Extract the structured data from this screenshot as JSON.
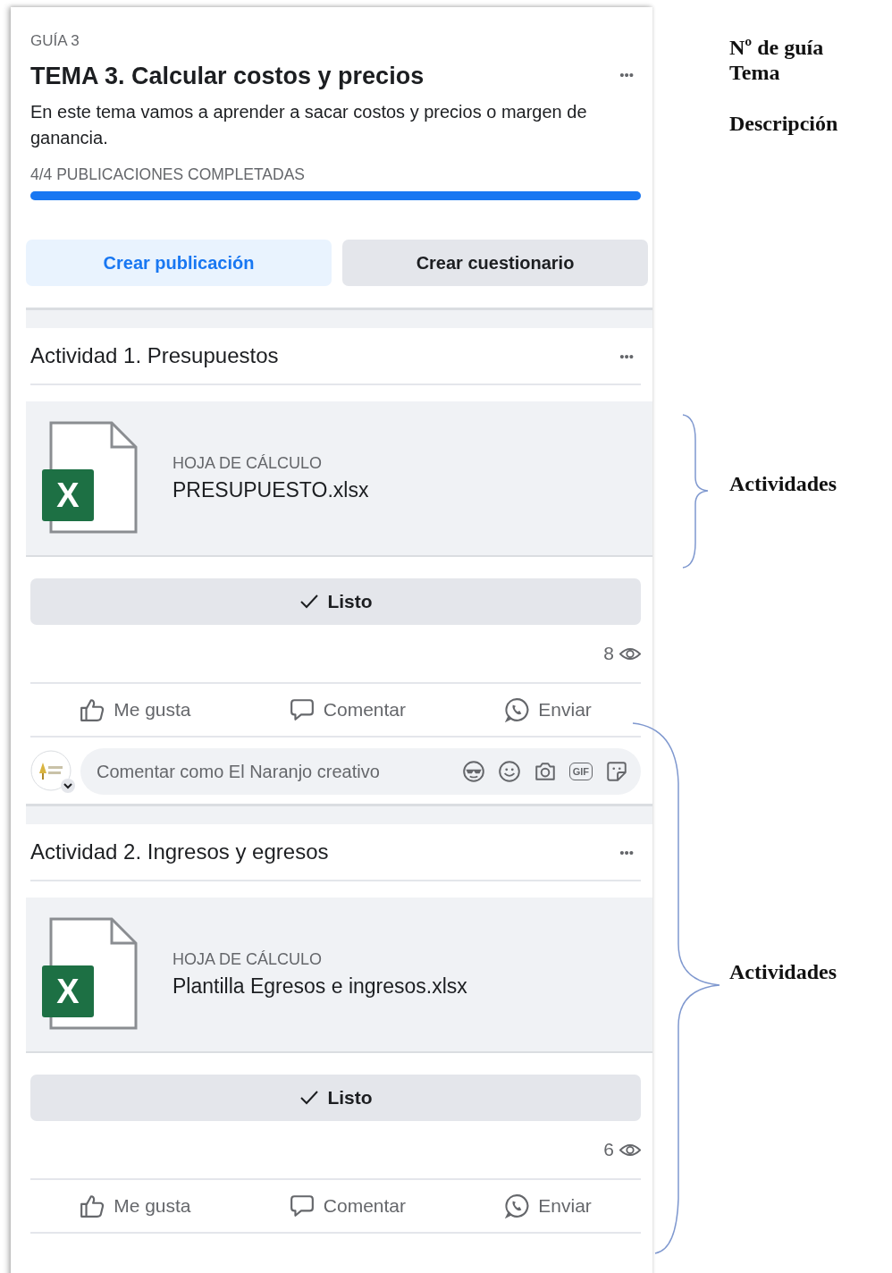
{
  "guide": {
    "label": "GUÍA 3",
    "title": "TEMA 3. Calcular costos y precios",
    "menu": "•••",
    "description": "En este tema vamos a aprender a sacar costos y precios o margen de ganancia.",
    "progress_text": "4/4 PUBLICACIONES COMPLETADAS",
    "level": 1
  },
  "buttons": [
    {
      "label": "Crear publicación",
      "kind": "primary"
    },
    {
      "label": "Crear cuestionario",
      "kind": "secondary"
    }
  ],
  "activities": [
    {
      "title": "Actividad 1. Presupuestos",
      "menu": "•••",
      "file": {
        "icon_letter": "X",
        "type_label": "HOJA DE CÁLCULO",
        "name": "PRESUPUESTO.xlsx"
      },
      "done_label": "Listo",
      "views": "8",
      "actions": [
        "Me gusta",
        "Comentar",
        "Enviar"
      ],
      "comment": {
        "placeholder": "Comentar como El Naranjo creativo",
        "gif_label": "GIF"
      }
    },
    {
      "title": "Actividad 2. Ingresos y egresos",
      "menu": "•••",
      "file": {
        "icon_letter": "X",
        "type_label": "HOJA DE CÁLCULO",
        "name": "Plantilla Egresos e ingresos.xlsx"
      },
      "done_label": "Listo",
      "views": "6",
      "actions": [
        "Me gusta",
        "Comentar",
        "Enviar"
      ]
    }
  ],
  "annotations": [
    {
      "text": "Nº de guía",
      "kind": "label"
    },
    {
      "text": "Tema",
      "kind": "label"
    },
    {
      "text": "Descripción",
      "kind": "label"
    },
    {
      "text": "Actividades",
      "kind": "brace"
    },
    {
      "text": "Actividades",
      "kind": "brace"
    }
  ]
}
